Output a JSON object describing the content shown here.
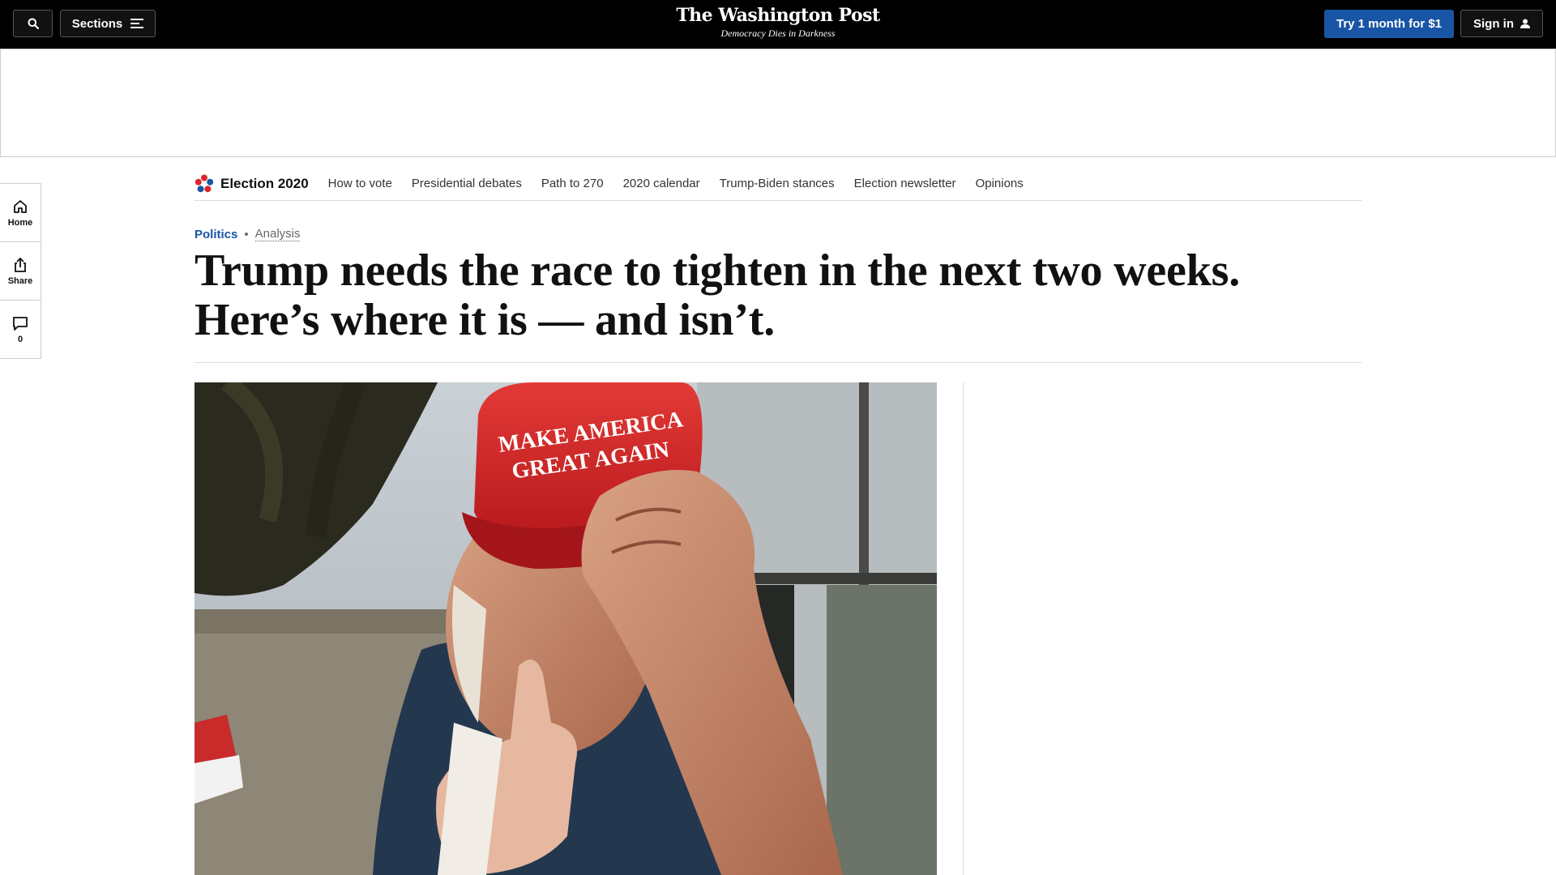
{
  "header": {
    "sections_label": "Sections",
    "logo_title": "The Washington Post",
    "logo_tagline": "Democracy Dies in Darkness",
    "subscribe_label": "Try 1 month for $1",
    "signin_label": "Sign in"
  },
  "rail": {
    "items": [
      {
        "label": "Home"
      },
      {
        "label": "Share"
      },
      {
        "label": "0"
      }
    ]
  },
  "nav": {
    "brand_label": "Election 2020",
    "links": [
      "How to vote",
      "Presidential debates",
      "Path to 270",
      "2020 calendar",
      "Trump-Biden stances",
      "Election newsletter",
      "Opinions"
    ]
  },
  "article": {
    "section": "Politics",
    "label": "Analysis",
    "headline": "Trump needs the race to tighten in the next two weeks. Here’s where it is — and isn’t.",
    "photo_hat_text": [
      "MAKE AMERICA",
      "GREAT AGAIN"
    ]
  },
  "colors": {
    "topbar": "#000000",
    "accent": "#1955a5",
    "hat_red": "#d8272b"
  }
}
